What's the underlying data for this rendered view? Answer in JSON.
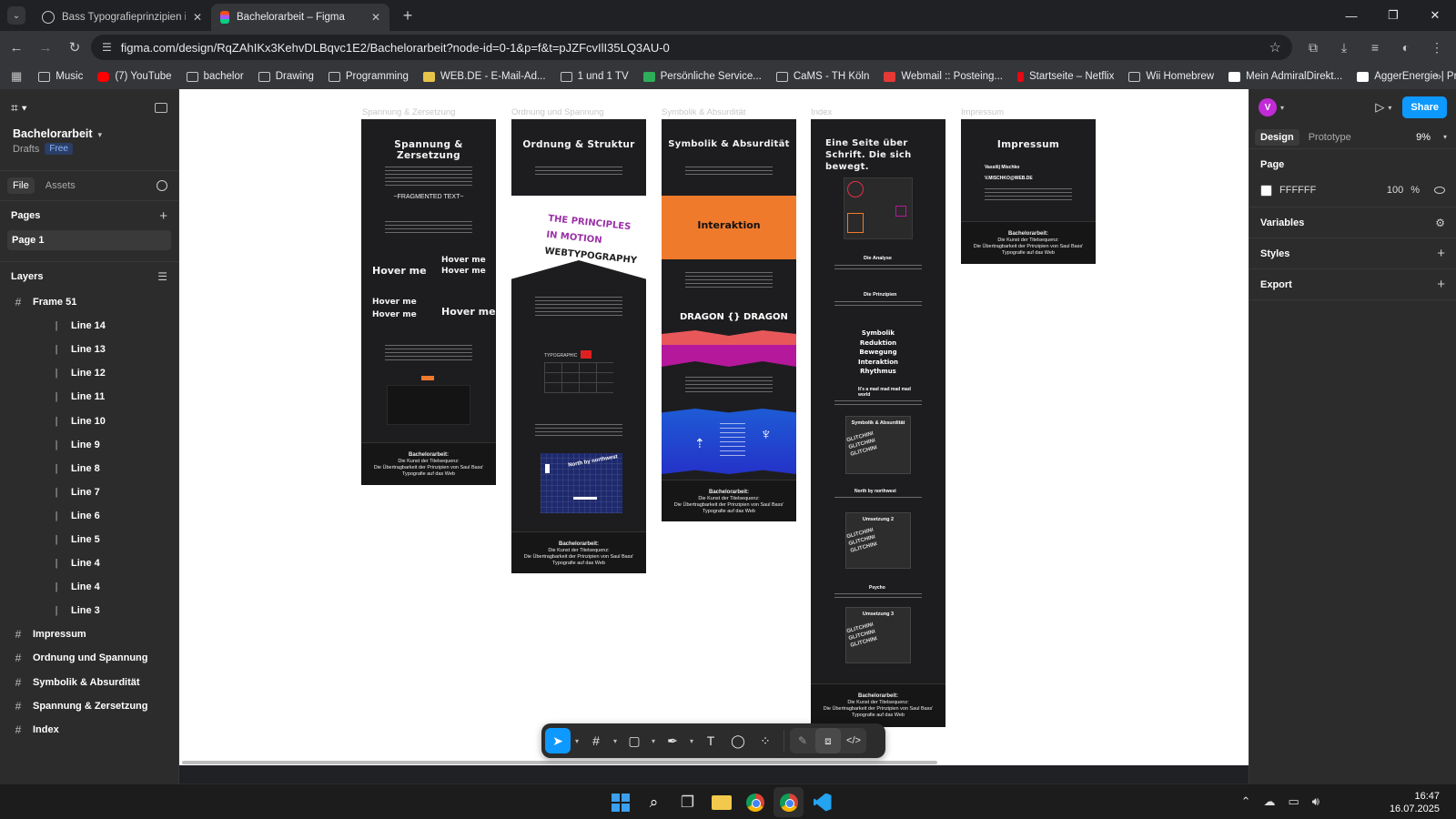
{
  "browser": {
    "tabs": [
      {
        "title": "Bass Typografieprinzipien im W"
      },
      {
        "title": "Bachelorarbeit – Figma"
      }
    ],
    "url": "figma.com/design/RqZAhIKx3KehvDLBqvc1E2/Bachelorarbeit?node-id=0-1&p=f&t=pJZFcvIlI35LQ3AU-0",
    "bookmarks": [
      "Music",
      "(7) YouTube",
      "bachelor",
      "Drawing",
      "Programming",
      "WEB.DE - E-Mail-Ad...",
      "1 und 1 TV",
      "Persönliche Service...",
      "CaMS - TH Köln",
      "Webmail :: Posteing...",
      "Startseite – Netflix",
      "Wii Homebrew",
      "Mein AdmiralDirekt...",
      "AggerEnergie | Priva..."
    ]
  },
  "figma": {
    "project_name": "Bachelorarbeit",
    "drafts_label": "Drafts",
    "plan_badge": "Free",
    "tabs": {
      "file": "File",
      "assets": "Assets"
    },
    "pages_label": "Pages",
    "current_page": "Page 1",
    "layers_label": "Layers",
    "frame51": "Frame 51",
    "sub_layers": [
      "Line 14",
      "Line 13",
      "Line 12",
      "Line 11",
      "Line 10",
      "Line 9",
      "Line 8",
      "Line 7",
      "Line 6",
      "Line 5",
      "Line 4",
      "Line 4",
      "Line 3"
    ],
    "top_layers": [
      "Impressum",
      "Ordnung und Spannung",
      "Symbolik & Absurdität",
      "Spannung & Zersetzung",
      "Index"
    ]
  },
  "canvas": {
    "frame_labels": [
      "Spannung & Zersetzung",
      "Ordnung und Spannung",
      "Symbolik & Absurdität",
      "Index",
      "Impressum"
    ],
    "f1": {
      "title": "Spannung & Zersetzung",
      "fragmented": "~FRAGMENTED TEXT~",
      "hover": "Hover me"
    },
    "f2": {
      "title": "Ordnung & Struktur",
      "principles": [
        "THE PRINCIPLES",
        "IN MOTION",
        "WEBTYPOGRAPHY"
      ],
      "typographic": "TYPOGRAPHIC",
      "nbn": "North by northwest"
    },
    "f3": {
      "title": "Symbolik & Absurdität",
      "interaktion": "Interaktion",
      "dragon": "DRAGON {} DRAGON"
    },
    "f4": {
      "title": "Eine Seite über Schrift. Die sich bewegt.",
      "analyse": "Die Analyse",
      "prinzipien": "Die Prinzipien",
      "list": [
        "Symbolik",
        "Reduktion",
        "Bewegung",
        "Interaktion",
        "Rhythmus"
      ],
      "mad": "It's a mad mad mad mad world",
      "symb": "Symbolik & Absurdität",
      "nbn": "North by northwest",
      "u2": "Umsetzung 2",
      "psycho": "Psycho",
      "u3": "Umsetzung 3",
      "glitch": "GLITCHING"
    },
    "f5": {
      "title": "Impressum",
      "name": "Vassilij Mischko",
      "email": "V.MISCHKO@WEB.DE"
    },
    "footer": {
      "title": "Bachelorarbeit:",
      "l1": "Die Kunst der Titelsequenz:",
      "l2": "Die Übertragbarkeit der Prinzipien von Saul Bass'",
      "l3": "Typografie auf das Web"
    }
  },
  "right": {
    "avatar": "V",
    "share": "Share",
    "tabs": {
      "design": "Design",
      "prototype": "Prototype"
    },
    "zoom": "9%",
    "page_label": "Page",
    "page_color": "FFFFFF",
    "page_opacity": "100",
    "percent": "%",
    "sections": [
      "Variables",
      "Styles",
      "Export"
    ]
  },
  "taskbar": {
    "time": "16:47",
    "date": "16.07.2025"
  },
  "colors": {
    "accent": "#0d99ff",
    "orange": "#f07a2c",
    "canvas": "#ffffff",
    "frame": "#1d1d1f"
  }
}
